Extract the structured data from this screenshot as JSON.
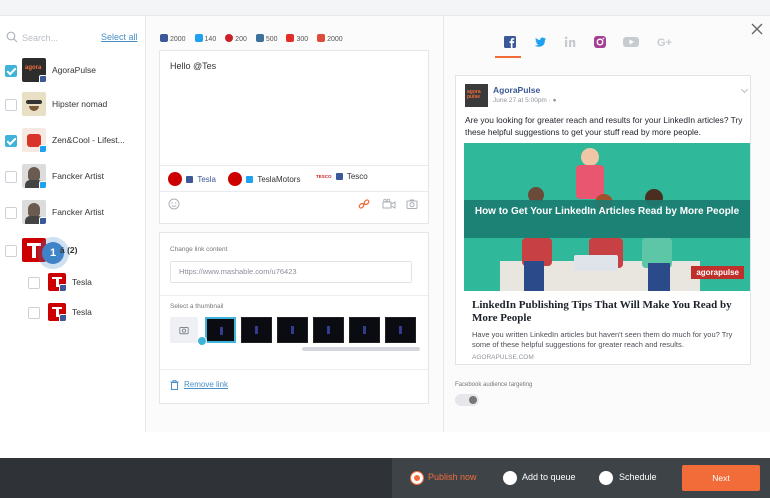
{
  "left_panel": {
    "search_placeholder": "Search...",
    "select_all": "Select all",
    "accounts": [
      {
        "name": "AgoraPulse",
        "checked": true,
        "network": "facebook"
      },
      {
        "name": "Hipster nomad",
        "checked": false,
        "network": "none"
      },
      {
        "name": "Zen&Cool - Lifest...",
        "checked": true,
        "network": "twitter"
      },
      {
        "name": "Fancker Artist",
        "checked": false,
        "network": "twitter"
      },
      {
        "name": "Fancker Artist",
        "checked": false,
        "network": "facebook"
      },
      {
        "name": "á (2)",
        "checked": false,
        "network": "group"
      },
      {
        "name": "Tesla",
        "checked": false,
        "network": "facebook"
      },
      {
        "name": "Tesla",
        "checked": false,
        "network": "facebook"
      }
    ],
    "step_badge": "1"
  },
  "composer": {
    "limits": [
      {
        "network": "facebook",
        "value": "2000",
        "color": "#3b5998"
      },
      {
        "network": "twitter",
        "value": "140",
        "color": "#1da1f2"
      },
      {
        "network": "pinterest",
        "value": "200",
        "color": "#cb2027"
      },
      {
        "network": "instagram",
        "value": "500",
        "color": "#3f729b"
      },
      {
        "network": "youtube",
        "value": "300",
        "color": "#e52d27"
      },
      {
        "network": "google-plus",
        "value": "2000",
        "color": "#dd4b39"
      }
    ],
    "message": "Hello @Tes",
    "mentions": [
      {
        "label": "Tesla",
        "network": "facebook"
      },
      {
        "label": "TeslaMotors",
        "network": "twitter"
      },
      {
        "label": "Tesco",
        "network": "facebook"
      }
    ],
    "mention_logo_text": "TESCO",
    "link_section": {
      "change_label": "Change link content",
      "url_value": "Https://www.mashable.com/u76423",
      "thumb_label": "Select a thumbnail",
      "remove_label": "Remove link"
    }
  },
  "preview": {
    "tabs": [
      "facebook",
      "twitter",
      "linkedin",
      "instagram",
      "youtube",
      "google-plus"
    ],
    "author": "AgoraPulse",
    "date": "June 27 at 5:00pm · ●",
    "avatar_text": "agora pulse",
    "text": "Are you looking for greater reach and results for your LinkedIn articles? Try these helpful suggestions to get your stuff read by more people.",
    "image_headline": "How to Get Your LinkedIn Articles Read by More People",
    "image_brand": "agorapulse",
    "link_title": "LinkedIn Publishing Tips That Will Make You Read by More People",
    "link_desc": "Have you written LinkedIn articles but haven't seen them do much for you? Try some of these helpful suggestions for greater reach and results.",
    "link_domain": "AGORAPULSE.COM",
    "targeting_label": "Facebook audience targeting",
    "targeting_enabled": false
  },
  "bottom_bar": {
    "options": [
      {
        "label": "Publish now",
        "selected": true
      },
      {
        "label": "Add to queue",
        "selected": false
      },
      {
        "label": "Schedule",
        "selected": false
      }
    ],
    "next_label": "Next"
  },
  "colors": {
    "accent": "#f26c3a",
    "link": "#4a90c8",
    "check": "#3fb4d8",
    "facebook": "#3b5998",
    "twitter": "#1da1f2"
  }
}
